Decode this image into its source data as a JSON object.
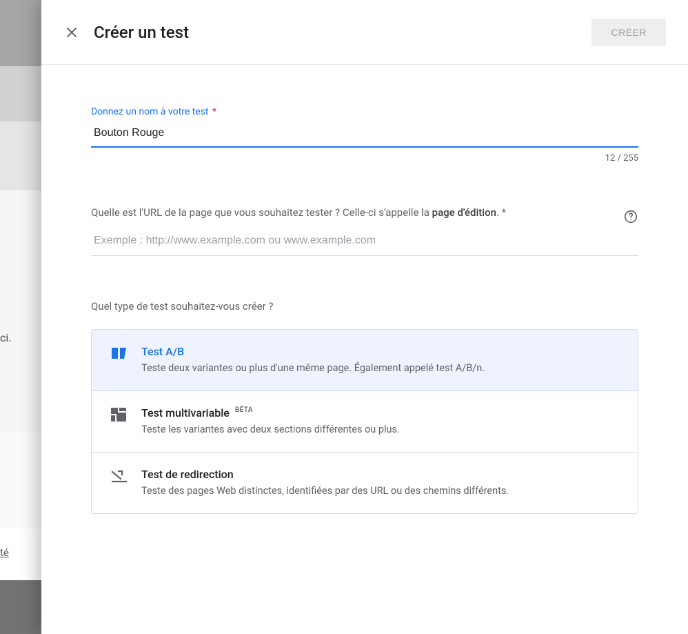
{
  "background": {
    "text_fragment_1": "ci.",
    "text_fragment_2": "té"
  },
  "header": {
    "title": "Créer un test",
    "create_button": "CRÉER"
  },
  "name_field": {
    "label": "Donnez un nom à votre test",
    "required_mark": "*",
    "value": "Bouton Rouge",
    "char_count": "12 / 255"
  },
  "url_field": {
    "label_before": "Quelle est l'URL de la page que vous souhaitez tester ? Celle-ci s'appelle la ",
    "label_strong": "page d'édition",
    "label_after": ". *",
    "placeholder": "Exemple : http://www.example.com ou www.example.com"
  },
  "type_section": {
    "label": "Quel type de test souhaitez-vous créer ?",
    "options": [
      {
        "title": "Test A/B",
        "badge": "",
        "desc": "Teste deux variantes ou plus d'une même page. Également appelé test A/B/n.",
        "selected": true
      },
      {
        "title": "Test multivariable",
        "badge": "BÊTA",
        "desc": "Teste les variantes avec deux sections différentes ou plus.",
        "selected": false
      },
      {
        "title": "Test de redirection",
        "badge": "",
        "desc": "Teste des pages Web distinctes, identifiées par des URL ou des chemins différents.",
        "selected": false
      }
    ]
  }
}
